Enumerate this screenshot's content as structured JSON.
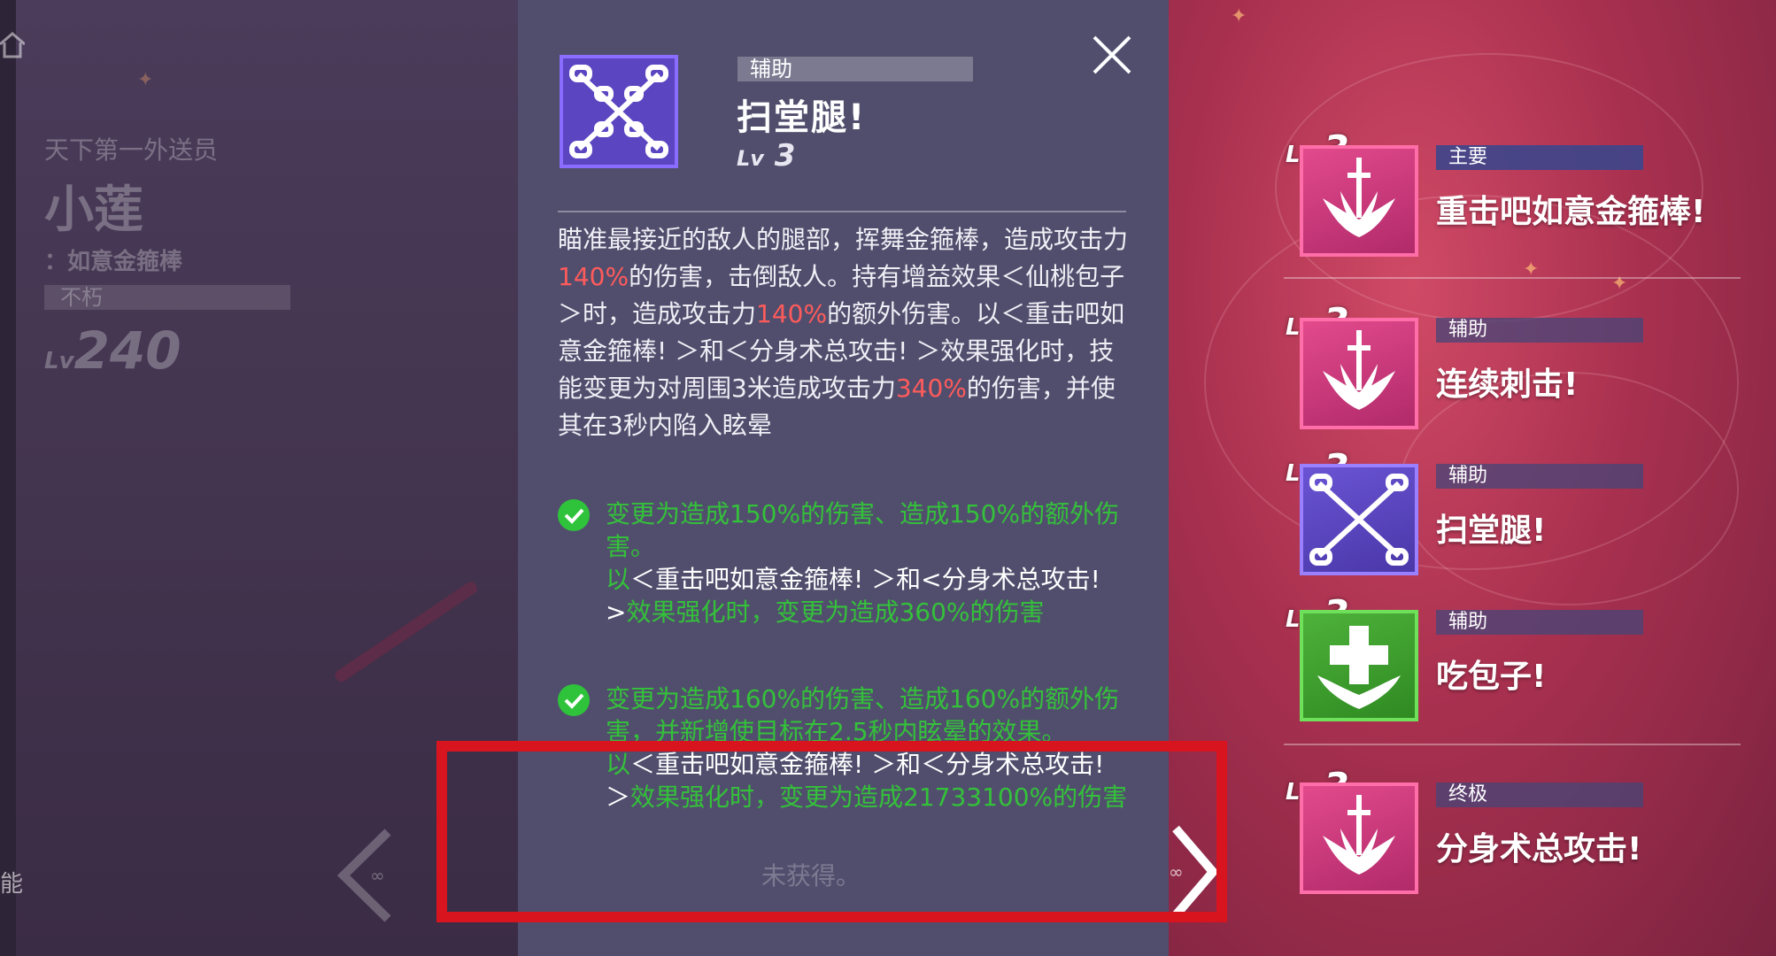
{
  "character": {
    "title": "天下第一外送员",
    "name": "小莲",
    "weapon": "：如意金箍棒",
    "rank": "不朽",
    "level_prefix": "Lv",
    "level": "240",
    "edge_char": "能"
  },
  "detail": {
    "type": "辅助",
    "name": "扫堂腿!",
    "level_prefix": "Lv",
    "level": "3",
    "description": [
      {
        "t": "瞄准最接近的敌人的腿部，挥舞金箍棒，造成攻击力",
        "c": ""
      },
      {
        "t": "140%",
        "c": "red"
      },
      {
        "t": "的伤害，击倒敌人。持有增益效果＜仙桃包子＞时，造成攻击力",
        "c": ""
      },
      {
        "t": "140%",
        "c": "red"
      },
      {
        "t": "的额外伤害。以＜重击吧如意金箍棒! ＞和＜分身术总攻击! ＞效果强化时，技能变更为对周围3米造成攻击力",
        "c": ""
      },
      {
        "t": "340%",
        "c": "red"
      },
      {
        "t": "的伤害，并使其在3秒内陷入眩晕",
        "c": ""
      }
    ],
    "upgrades": [
      [
        {
          "t": "变更为造成150%的伤害、造成150%的额外伤害。",
          "c": "green"
        },
        {
          "t": "\n",
          "c": ""
        },
        {
          "t": "以",
          "c": "green"
        },
        {
          "t": "＜重击吧如意金箍棒! ＞和<分身术总攻击! >",
          "c": ""
        },
        {
          "t": "效果强化时，变更为造成360%的伤害",
          "c": "green"
        }
      ],
      [
        {
          "t": "变更为造成160%的伤害、造成160%的额外伤害，并新增使目标在2.5秒内眩晕的效果。",
          "c": "green"
        },
        {
          "t": "\n",
          "c": ""
        },
        {
          "t": "以",
          "c": "green"
        },
        {
          "t": "＜重击吧如意金箍棒! ＞和＜分身术总攻击! ＞",
          "c": ""
        },
        {
          "t": "效果强化时，变更为造成21733100%的伤害",
          "c": "green"
        }
      ]
    ],
    "ghost_text": "未获得。"
  },
  "skills": [
    {
      "lv_prefix": "Lv",
      "lv": "3",
      "type": "主要",
      "name": "重击吧如意金箍棒!",
      "icon": "sword-icon",
      "color": "#e24a8c"
    },
    {
      "lv_prefix": "Lv",
      "lv": "3",
      "type": "辅助",
      "name": "连续刺击!",
      "icon": "sword-icon",
      "color": "#e24a8c"
    },
    {
      "lv_prefix": "Lv",
      "lv": "3",
      "type": "辅助",
      "name": "扫堂腿!",
      "icon": "crossed-chains-icon",
      "color": "#6a54d4"
    },
    {
      "lv_prefix": "Lv",
      "lv": "3",
      "type": "辅助",
      "name": "吃包子!",
      "icon": "heal-cross-icon",
      "color": "#4eb23a"
    },
    {
      "lv_prefix": "Lv",
      "lv": "3",
      "type": "终极",
      "name": "分身术总攻击!",
      "icon": "sword-icon",
      "color": "#e24a8c"
    }
  ],
  "colors": {
    "highlight": "#d8141e",
    "damage_red": "#ff5b5b",
    "upgrade_green": "#34c13a",
    "panel": "#52506e"
  }
}
